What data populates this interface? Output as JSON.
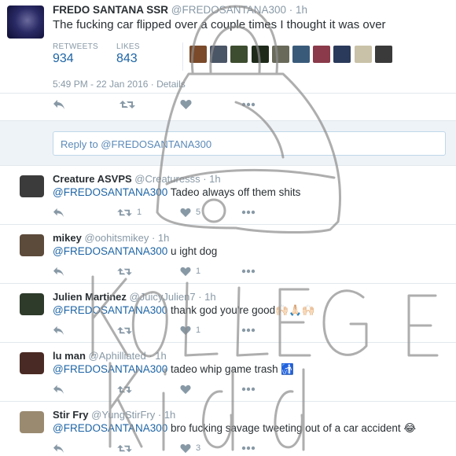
{
  "main_tweet": {
    "name": "FREDO SANTANA SSR",
    "handle": "@FREDOSANTANA300",
    "time": "· 1h",
    "text": "The fucking car flipped over a couple times I thought it was over",
    "retweets_label": "RETWEETS",
    "retweets_count": "934",
    "likes_label": "LIKES",
    "likes_count": "843",
    "timestamp": "5:49 PM - 22 Jan 2016 · Details"
  },
  "liker_colors": [
    "#7a4a2a",
    "#4a5566",
    "#3d4d2f",
    "#1f2a1a",
    "#6a6a5a",
    "#3a5a7a",
    "#8a3a4a",
    "#2a3a5a",
    "#c9c2a8",
    "#3a3a3a"
  ],
  "reply_box": {
    "placeholder": "Reply to @FREDOSANTANA300"
  },
  "replies": [
    {
      "name": "Creature ASVPS",
      "handle": "@Creaturesss",
      "time": "· 1h",
      "mention": "@FREDOSANTANA300",
      "text": " Tadeo always off them shits",
      "retweets": "1",
      "likes": "5",
      "avatar_color": "#3b3b3b"
    },
    {
      "name": "mikey",
      "handle": "@oohitsmikey",
      "time": "· 1h",
      "mention": "@FREDOSANTANA300",
      "text": " u ight dog",
      "retweets": "",
      "likes": "1",
      "avatar_color": "#5c4a3a"
    },
    {
      "name": "Julien Martinez",
      "handle": "@JuicyJulien7",
      "time": "· 1h",
      "mention": "@FREDOSANTANA300",
      "text": " thank god you're good🙌🏻🙏🏻🙌🏻",
      "retweets": "",
      "likes": "1",
      "avatar_color": "#2e3a2a"
    },
    {
      "name": "lu man",
      "handle": "@Aphilliated",
      "time": "· 1h",
      "mention": "@FREDOSANTANA300",
      "text": " tadeo whip game trash 🚮",
      "retweets": "",
      "likes": "",
      "avatar_color": "#4a2a24"
    },
    {
      "name": "Stir Fry",
      "handle": "@YungStirFry",
      "time": "· 1h",
      "mention": "@FREDOSANTANA300",
      "text": " bro fucking savage tweeting out of a car accident 😂",
      "retweets": "",
      "likes": "3",
      "avatar_color": "#9a8a70"
    }
  ],
  "colors": {
    "link_blue": "#1d64a5",
    "meta_gray": "#8899a6",
    "icon_gray": "#8899a6",
    "divider": "#e1e8ed",
    "reply_bg": "#eef3f7"
  }
}
